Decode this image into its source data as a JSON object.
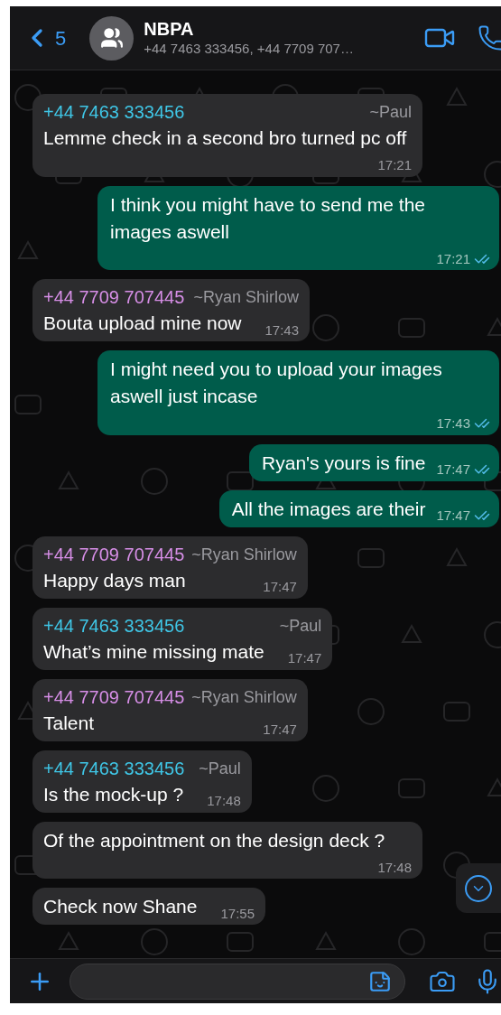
{
  "header": {
    "back_count": "5",
    "title": "NBPA",
    "subtitle": "+44 7463 333456, +44 7709 707…"
  },
  "messages": [
    {
      "kind": "incoming",
      "sender": "+44 7463 333456",
      "color": "#3fc6e6",
      "name": "~Paul",
      "text": "Lemme check in a second bro turned pc off",
      "time": "17:21"
    },
    {
      "kind": "outgoing",
      "text": "I think you might have to send me the images aswell",
      "time": "17:21",
      "read": true
    },
    {
      "kind": "incoming",
      "sender": "+44 7709 707445",
      "color": "#d68ee6",
      "name": "~Ryan Shirlow",
      "text": "Bouta upload mine now",
      "time": "17:43"
    },
    {
      "kind": "outgoing",
      "text": "I might need you to upload your images aswell just incase",
      "time": "17:43",
      "read": true
    },
    {
      "kind": "outgoing",
      "text": "Ryan's yours is fine",
      "time": "17:47",
      "read": true
    },
    {
      "kind": "outgoing",
      "text": "All the images are their",
      "time": "17:47",
      "read": true
    },
    {
      "kind": "incoming",
      "sender": "+44 7709 707445",
      "color": "#d68ee6",
      "name": "~Ryan Shirlow",
      "text": "Happy days man",
      "time": "17:47"
    },
    {
      "kind": "incoming",
      "sender": "+44 7463 333456",
      "color": "#3fc6e6",
      "name": "~Paul",
      "text": "What’s mine missing mate",
      "time": "17:47"
    },
    {
      "kind": "incoming",
      "sender": "+44 7709 707445",
      "color": "#d68ee6",
      "name": "~Ryan Shirlow",
      "text": "Talent",
      "time": "17:47"
    },
    {
      "kind": "incoming",
      "sender": "+44 7463 333456",
      "color": "#3fc6e6",
      "name": "~Paul",
      "text": "Is the mock-up ?",
      "time": "17:48"
    },
    {
      "kind": "incoming",
      "text": "Of the appointment on the design deck ?",
      "time": "17:48"
    },
    {
      "kind": "incoming",
      "text": "Check now Shane",
      "time": "17:55"
    }
  ]
}
